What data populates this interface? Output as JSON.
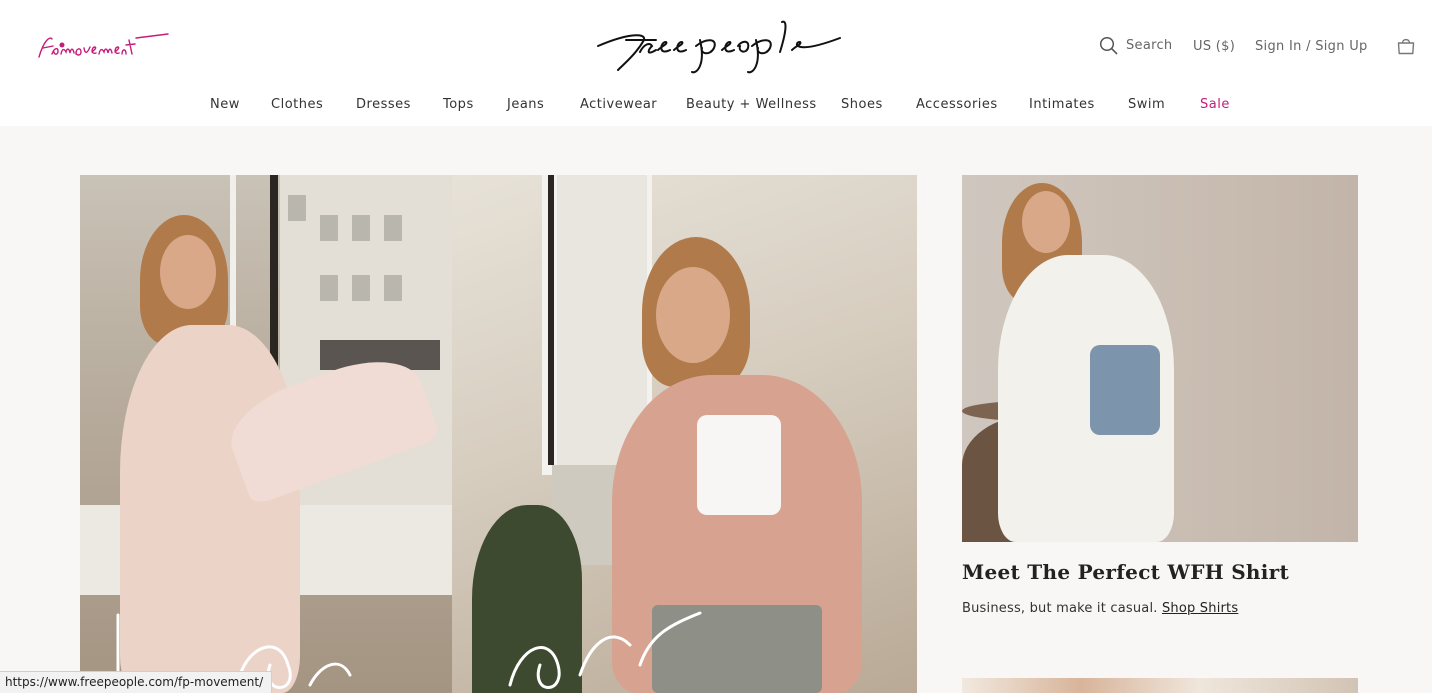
{
  "header": {
    "sub_brand": "fp movement",
    "brand": "free people",
    "search_label": "Search",
    "currency": "US ($)",
    "signin": "Sign In / Sign Up",
    "bag_icon": "shopping-bag-icon",
    "search_icon": "search-icon"
  },
  "nav": {
    "items": [
      {
        "label": "New"
      },
      {
        "label": "Clothes"
      },
      {
        "label": "Dresses"
      },
      {
        "label": "Tops"
      },
      {
        "label": "Jeans"
      },
      {
        "label": "Activewear"
      },
      {
        "label": "Beauty + Wellness"
      },
      {
        "label": "Shoes"
      },
      {
        "label": "Accessories"
      },
      {
        "label": "Intimates"
      },
      {
        "label": "Swim"
      },
      {
        "label": "Sale"
      }
    ],
    "sale_color": "#c41c7b"
  },
  "hero": {
    "script_text": "lounge comfort"
  },
  "promo": {
    "title": "Meet The Perfect WFH Shirt",
    "subtitle": "Business, but make it casual.",
    "link": "Shop Shirts"
  },
  "status_bar": {
    "url": "https://www.freepeople.com/fp-movement/"
  },
  "colors": {
    "accent": "#c41c7b",
    "background": "#f8f7f5",
    "header_bg": "#ffffff"
  }
}
